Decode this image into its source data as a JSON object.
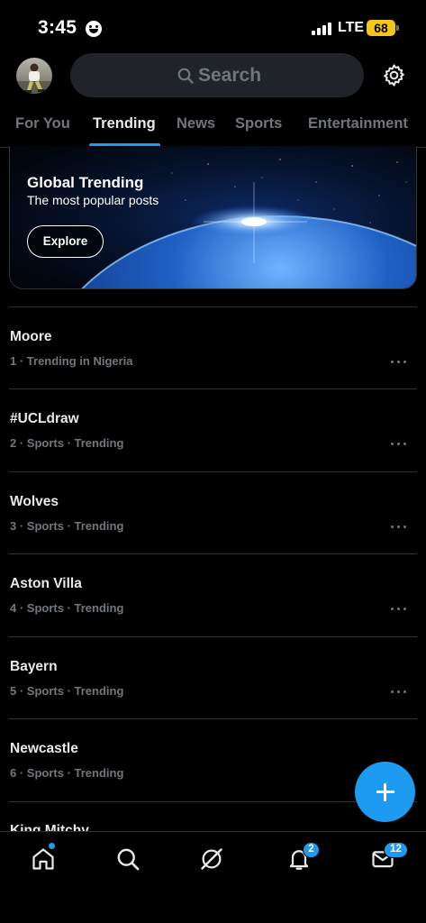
{
  "status_bar": {
    "time": "3:45",
    "network": "LTE",
    "battery": "68"
  },
  "header": {
    "search_placeholder": "Search"
  },
  "tabs": [
    {
      "label": "For You",
      "active": false
    },
    {
      "label": "Trending",
      "active": true
    },
    {
      "label": "News",
      "active": false
    },
    {
      "label": "Sports",
      "active": false
    },
    {
      "label": "Entertainment",
      "active": false
    }
  ],
  "banner": {
    "title": "Global Trending",
    "subtitle": "The most popular posts",
    "button": "Explore"
  },
  "trends": [
    {
      "title": "Moore",
      "meta": "1 · Trending in Nigeria"
    },
    {
      "title": "#UCLdraw",
      "meta": "2 · Sports · Trending"
    },
    {
      "title": "Wolves",
      "meta": "3 · Sports · Trending"
    },
    {
      "title": "Aston Villa",
      "meta": "4 · Sports · Trending"
    },
    {
      "title": "Bayern",
      "meta": "5 · Sports · Trending"
    },
    {
      "title": "Newcastle",
      "meta": "6 · Sports · Trending"
    },
    {
      "title": "King Mitchy",
      "meta": ""
    }
  ],
  "bottom_nav": {
    "items": [
      "home-icon",
      "search-icon",
      "grok-icon",
      "notifications-icon",
      "messages-icon"
    ],
    "notifications_badge": "2",
    "messages_badge": "12"
  },
  "colors": {
    "accent": "#1d9bf0",
    "background": "#000000",
    "battery": "#f5c518"
  }
}
